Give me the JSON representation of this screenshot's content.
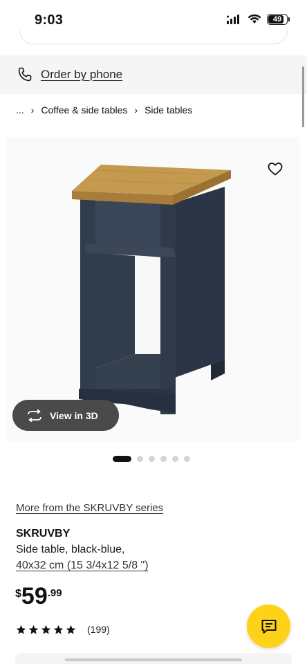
{
  "status_bar": {
    "time": "9:03",
    "battery": "49"
  },
  "contact": {
    "order_by_phone": "Order by phone",
    "icon": "phone-icon"
  },
  "breadcrumb": {
    "ellipsis": "...",
    "items": [
      "Coffee & side tables",
      "Side tables"
    ]
  },
  "gallery": {
    "favorite_icon": "heart-icon",
    "view3d_label": "View in 3D",
    "dots_total": 6,
    "dot_active_index": 0
  },
  "product": {
    "series_link": "More from the SKRUVBY series",
    "name": "SKRUVBY",
    "description": "Side table, black-blue,",
    "size": "40x32 cm (15 3/4x12 5/8 \")",
    "price": {
      "currency": "$",
      "integer": "59",
      "cents": ".99"
    },
    "rating": {
      "stars": 5,
      "max": 5,
      "count": "(199)"
    }
  },
  "chat": {
    "icon": "chat-icon"
  },
  "colors": {
    "accent_yellow": "#ffd21a",
    "text": "#111111",
    "view3d_bg": "#4a4a4a",
    "table_top": "#c49a4e",
    "table_body": "#2f3a4b"
  }
}
